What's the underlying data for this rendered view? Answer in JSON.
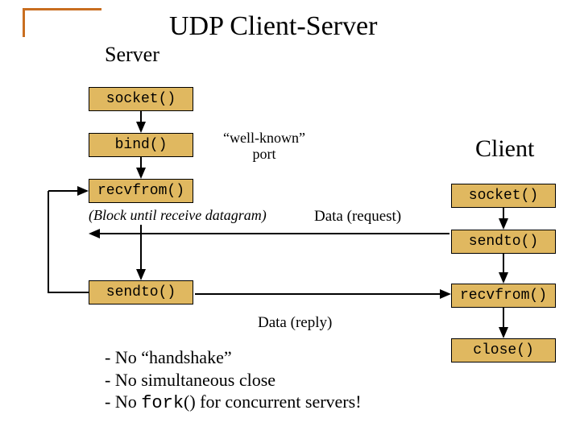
{
  "title": "UDP Client-Server",
  "labels": {
    "server": "Server",
    "client": "Client",
    "wellknown_line1": "“well-known”",
    "wellknown_line2": "port",
    "block_until": "(Block until receive datagram)",
    "data_request": "Data (request)",
    "data_reply": "Data (reply)"
  },
  "server": {
    "socket": "socket()",
    "bind": "bind()",
    "recvfrom": "recvfrom()",
    "sendto": "sendto()"
  },
  "client": {
    "socket": "socket()",
    "sendto": "sendto()",
    "recvfrom": "recvfrom()",
    "close": "close()"
  },
  "notes": {
    "n1": "- No “handshake”",
    "n2": "- No simultaneous close",
    "n3_a": "- No ",
    "n3_b": "fork",
    "n3_c": "() for concurrent servers!"
  }
}
